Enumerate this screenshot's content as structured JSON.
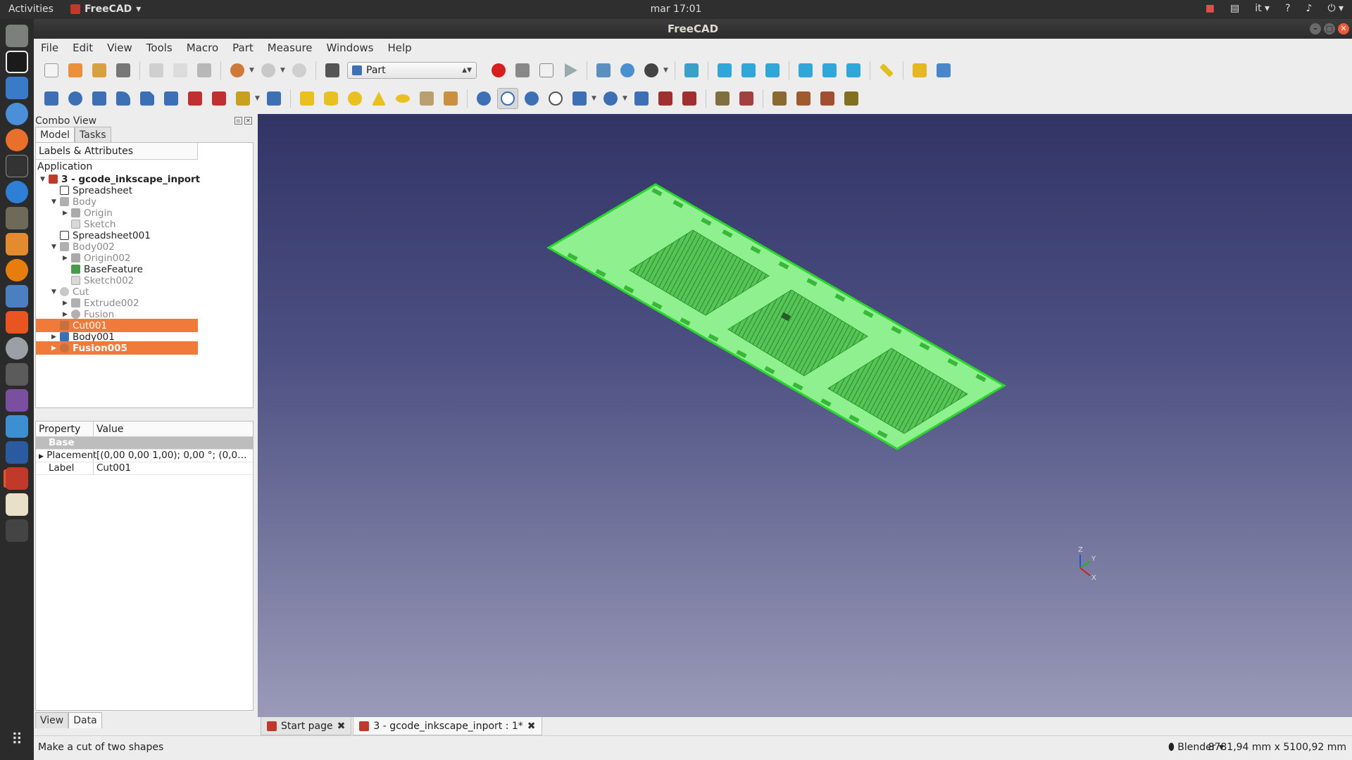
{
  "topbar": {
    "activities": "Activities",
    "app_name": "FreeCAD",
    "clock": "mar 17:01",
    "language": "it"
  },
  "window": {
    "title": "FreeCAD"
  },
  "menu": [
    "File",
    "Edit",
    "View",
    "Tools",
    "Macro",
    "Part",
    "Measure",
    "Windows",
    "Help"
  ],
  "workbench": "Part",
  "combo": {
    "title": "Combo View",
    "tabs": [
      "Model",
      "Tasks"
    ],
    "tree_header": "Labels & Attributes",
    "application": "Application",
    "items": [
      {
        "label": "3 - gcode_inkscape_inport",
        "icon": "document-icon",
        "state": "root"
      },
      {
        "label": "Spreadsheet",
        "icon": "spreadsheet-icon",
        "state": "normal"
      },
      {
        "label": "Body",
        "icon": "body-icon",
        "state": "hidden"
      },
      {
        "label": "Origin",
        "icon": "origin-icon",
        "state": "hidden"
      },
      {
        "label": "Sketch",
        "icon": "sketch-icon",
        "state": "hidden"
      },
      {
        "label": "Spreadsheet001",
        "icon": "spreadsheet-icon",
        "state": "normal"
      },
      {
        "label": "Body002",
        "icon": "body-icon",
        "state": "hidden"
      },
      {
        "label": "Origin002",
        "icon": "origin-icon",
        "state": "hidden"
      },
      {
        "label": "BaseFeature",
        "icon": "basefeature-icon",
        "state": "normal"
      },
      {
        "label": "Sketch002",
        "icon": "sketch-icon",
        "state": "hidden"
      },
      {
        "label": "Cut",
        "icon": "cut-icon",
        "state": "hidden"
      },
      {
        "label": "Extrude002",
        "icon": "extrude-icon",
        "state": "hidden"
      },
      {
        "label": "Fusion",
        "icon": "fusion-icon",
        "state": "hidden"
      },
      {
        "label": "Cut001",
        "icon": "cut-icon",
        "state": "selected"
      },
      {
        "label": "Body001",
        "icon": "body-icon",
        "state": "normal"
      },
      {
        "label": "Fusion005",
        "icon": "fusion-icon",
        "state": "selected-bold"
      }
    ],
    "property_headers": [
      "Property",
      "Value"
    ],
    "property_group": "Base",
    "properties": [
      {
        "name": "Placement",
        "value": "[(0,00 0,00 1,00); 0,00 °; (0,00 mm  0,00 ..."
      },
      {
        "name": "Label",
        "value": "Cut001"
      }
    ],
    "bottom_tabs": [
      "View",
      "Data"
    ]
  },
  "doc_tabs": [
    {
      "label": "Start page"
    },
    {
      "label": "3 - gcode_inkscape_inport : 1*"
    }
  ],
  "status": {
    "message": "Make a cut of two shapes",
    "navigation": "Blender",
    "dimensions": "8781,94 mm x 5100,92 mm"
  },
  "axis_labels": {
    "z": "Z",
    "y": "Y",
    "x": "X"
  },
  "colors": {
    "selection": "#f07a3a",
    "model_fill": "#8ef08e",
    "model_edge": "#2ad62a"
  }
}
